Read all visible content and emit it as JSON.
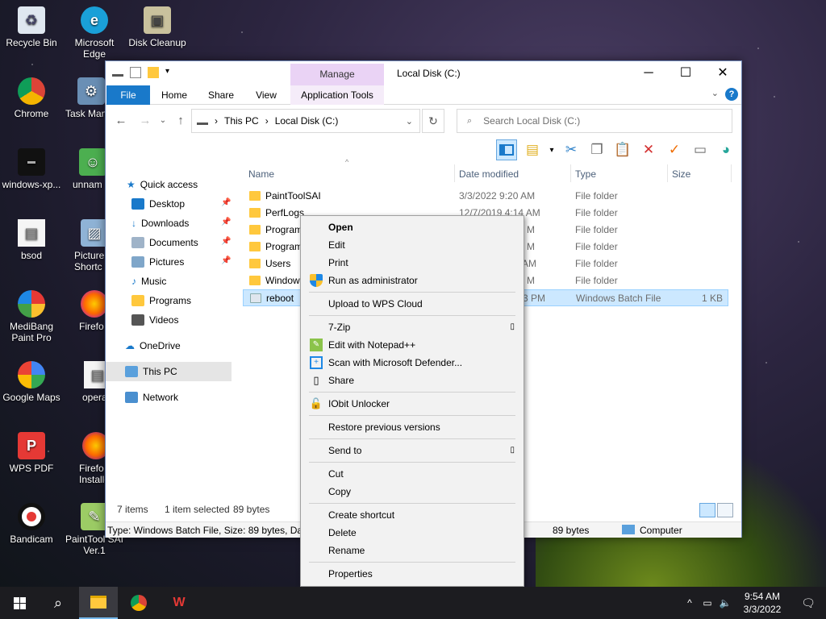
{
  "desktop": {
    "icons": [
      {
        "label": "Recycle Bin",
        "icon": "recycle-bin-icon"
      },
      {
        "label": "Microsoft Edge",
        "icon": "edge-icon"
      },
      {
        "label": "Disk Cleanup",
        "icon": "disk-cleanup-icon"
      },
      {
        "label": "Chrome",
        "icon": "chrome-icon"
      },
      {
        "label": "Task Man",
        "icon": "task-manager-icon"
      },
      {
        "label": "windows-xp...",
        "icon": "shortcut-icon"
      },
      {
        "label": "unnam",
        "icon": "image-icon"
      },
      {
        "label": "bsod",
        "icon": "file-icon"
      },
      {
        "label": "Picture Shortc",
        "icon": "picture-shortcut-icon"
      },
      {
        "label": "MediBang Paint Pro",
        "icon": "medibang-icon"
      },
      {
        "label": "Firefo",
        "icon": "firefox-icon"
      },
      {
        "label": "Google Maps",
        "icon": "google-maps-icon"
      },
      {
        "label": "opera",
        "icon": "file-icon"
      },
      {
        "label": "WPS PDF",
        "icon": "wps-pdf-icon"
      },
      {
        "label": "Firefo Installe",
        "icon": "firefox-installer-icon"
      },
      {
        "label": "Bandicam",
        "icon": "bandicam-icon"
      },
      {
        "label": "PaintTool SAI Ver.1",
        "icon": "painttool-sai-icon"
      }
    ]
  },
  "window": {
    "title": "Local Disk (C:)",
    "manage_tab": "Manage",
    "tabs": [
      "File",
      "Home",
      "Share",
      "View",
      "Application Tools"
    ],
    "caption": {
      "minimize": "─",
      "maximize": "☐",
      "close": "✕"
    },
    "help": "?",
    "address": {
      "parts": [
        "This PC",
        "Local Disk (C:)"
      ],
      "sep": "›"
    },
    "search_placeholder": "Search Local Disk (C:)",
    "nav": {
      "quick_access": "Quick access",
      "items": [
        "Desktop",
        "Downloads",
        "Documents",
        "Pictures",
        "Music",
        "Programs",
        "Videos"
      ],
      "onedrive": "OneDrive",
      "thispc": "This PC",
      "network": "Network"
    },
    "columns": {
      "name": "Name",
      "date": "Date modified",
      "type": "Type",
      "size": "Size"
    },
    "files": [
      {
        "name": "PaintToolSAI",
        "date": "3/3/2022 9:20 AM",
        "type": "File folder",
        "size": ""
      },
      {
        "name": "PerfLogs",
        "date": "12/7/2019 4:14 AM",
        "type": "File folder",
        "size": ""
      },
      {
        "name": "Program",
        "date": "M",
        "type": "File folder",
        "size": ""
      },
      {
        "name": "Program",
        "date": "M",
        "type": "File folder",
        "size": ""
      },
      {
        "name": "Users",
        "date": "AM",
        "type": "File folder",
        "size": ""
      },
      {
        "name": "Window",
        "date": "M",
        "type": "File folder",
        "size": ""
      },
      {
        "name": "reboot",
        "date": "3 PM",
        "type": "Windows Batch File",
        "size": "1 KB"
      }
    ],
    "status": {
      "count": "7 items",
      "selected": "1 item selected",
      "bytes": "89 bytes"
    },
    "details": {
      "left": "Type: Windows Batch File, Size: 89 bytes, Date",
      "bytes": "89 bytes",
      "computer": "Computer"
    }
  },
  "context_menu": {
    "items": {
      "open": "Open",
      "edit": "Edit",
      "print": "Print",
      "runadmin": "Run as administrator",
      "wps": "Upload to WPS Cloud",
      "zip": "7-Zip",
      "notepad": "Edit with Notepad++",
      "defender": "Scan with Microsoft Defender...",
      "share": "Share",
      "iobit": "IObit Unlocker",
      "restore": "Restore previous versions",
      "sendto": "Send to",
      "cut": "Cut",
      "copy": "Copy",
      "shortcut": "Create shortcut",
      "delete": "Delete",
      "rename": "Rename",
      "properties": "Properties"
    }
  },
  "taskbar": {
    "time": "9:54 AM",
    "date": "3/3/2022"
  },
  "colors": {
    "accent": "#1979ca",
    "selection": "#cce8ff",
    "folder": "#ffc83d"
  }
}
